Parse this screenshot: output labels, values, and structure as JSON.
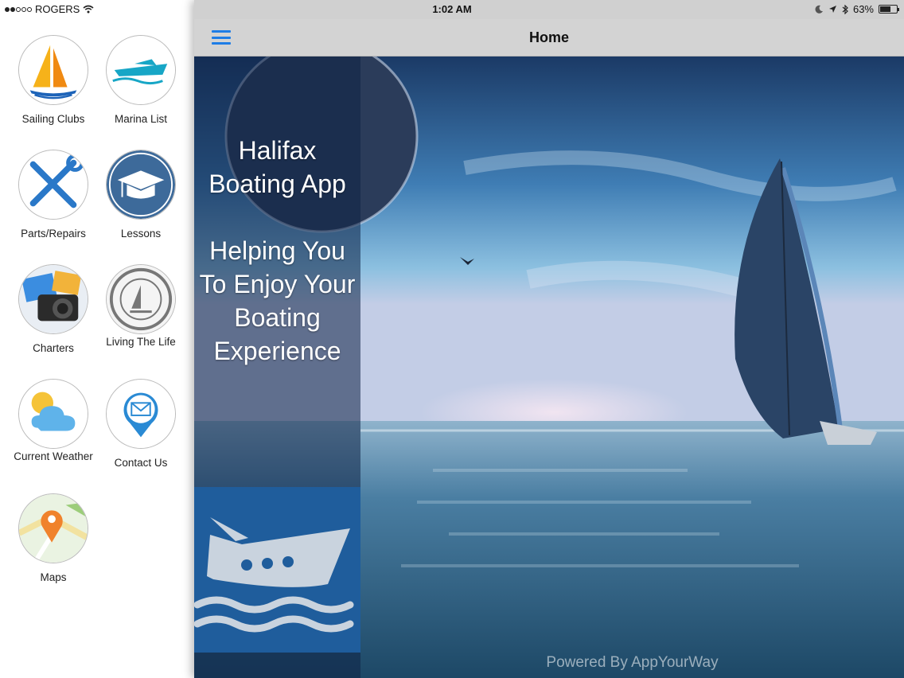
{
  "status_bar": {
    "carrier": "ROGERS",
    "time": "1:02 AM",
    "battery_percent": "63%",
    "battery_level": 0.63,
    "icons": [
      "signal-dots-icon",
      "wifi-icon",
      "moon-icon",
      "location-arrow-icon",
      "bluetooth-icon",
      "battery-icon"
    ]
  },
  "nav": {
    "title": "Home",
    "menu_icon": "hamburger-menu-icon"
  },
  "drawer": {
    "items": [
      {
        "label": "Sailing Clubs",
        "icon": "sailboat-icon"
      },
      {
        "label": "Marina List",
        "icon": "speedboat-icon"
      },
      {
        "label": "Parts/Repairs",
        "icon": "tools-icon"
      },
      {
        "label": "Lessons",
        "icon": "graduation-cap-icon"
      },
      {
        "label": "Charters",
        "icon": "camera-icon"
      },
      {
        "label": "Living The Life",
        "icon": "cruising-stamp-icon"
      },
      {
        "label": "Current Weather",
        "icon": "weather-icon"
      },
      {
        "label": "Contact Us",
        "icon": "mail-pin-icon"
      },
      {
        "label": "Maps",
        "icon": "map-pin-icon"
      }
    ]
  },
  "hero": {
    "title": "Halifax Boating App",
    "tagline": "Helping You To Enjoy Your Boating Experience",
    "footer": "Powered By AppYourWay"
  },
  "colors": {
    "accent": "#1e7de6",
    "boat_tile": "#1f5d9c",
    "nav_bg": "#d3d3d3"
  }
}
